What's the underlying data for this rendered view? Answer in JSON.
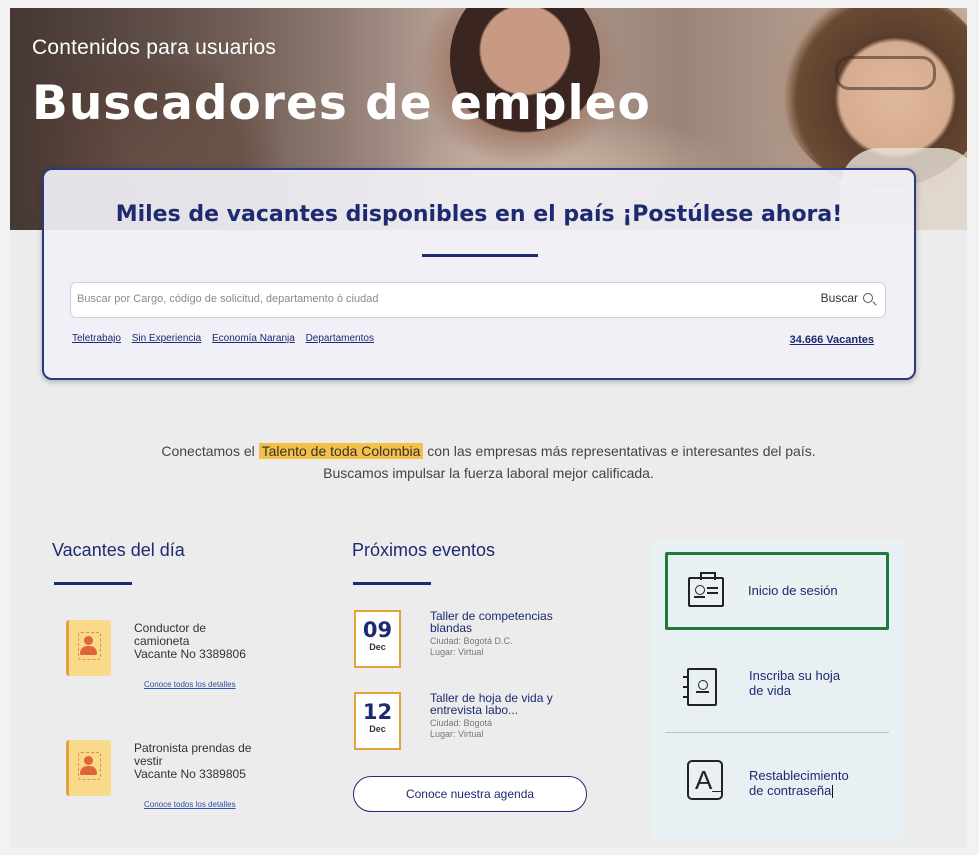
{
  "hero": {
    "subtitle": "Contenidos para usuarios",
    "title": "Buscadores de empleo"
  },
  "search": {
    "headline": "Miles de vacantes disponibles en el país ¡Postúlese ahora!",
    "placeholder": "Buscar por Cargo, código de solicitud, departamento ó ciudad",
    "button_label": "Buscar",
    "quick_links": [
      "Teletrabajo",
      "Sin Experiencia",
      "Economía Naranja",
      "Departamentos"
    ],
    "vacancy_count": "34.666 Vacantes"
  },
  "tagline": {
    "prefix": "Conectamos el ",
    "highlight": "Talento de toda Colombia",
    "suffix": " con las empresas más representativas e interesantes del país.",
    "line2": "Buscamos impulsar la fuerza laboral mejor calificada."
  },
  "vacancies": {
    "title": "Vacantes del día",
    "items": [
      {
        "name_line1": "Conductor de",
        "name_line2": "camioneta",
        "number": "Vacante No 3389806",
        "link": "Conoce todos los detalles"
      },
      {
        "name_line1": "Patronista prendas de",
        "name_line2": "vestir",
        "number": "Vacante No 3389805",
        "link": "Conoce todos los detalles"
      }
    ]
  },
  "events": {
    "title": "Próximos eventos",
    "items": [
      {
        "day": "09",
        "month": "Dec",
        "title": "Taller de competencias blandas",
        "city": "Ciudad: Bogotá D.C.",
        "place": "Lugar: Virtual"
      },
      {
        "day": "12",
        "month": "Dec",
        "title": "Taller de hoja de vida y entrevista labo...",
        "city": "Ciudad: Bogotá",
        "place": "Lugar: Virtual"
      }
    ],
    "agenda_button": "Conoce nuestra agenda"
  },
  "side_panel": {
    "login": "Inicio de sesión",
    "register_line1": "Inscriba su hoja",
    "register_line2": "de vida",
    "reset_line1": "Restablecimiento",
    "reset_line2": "de contraseña"
  },
  "colors": {
    "navy": "#1d2a70",
    "highlight": "#f5c048",
    "login_border": "#1f7a3a",
    "vacancy_icon": "#f9d98a"
  }
}
